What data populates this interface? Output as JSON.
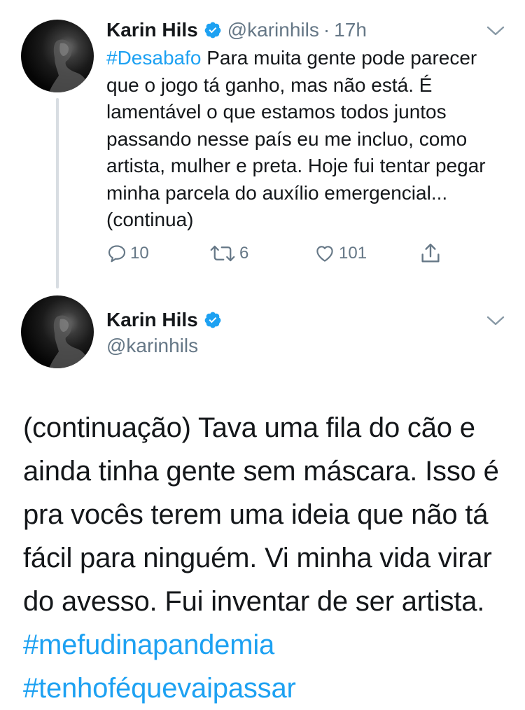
{
  "tweets": [
    {
      "name": "Karin Hils",
      "handle": "@karinhils",
      "separator": "·",
      "time": "17h",
      "hashtag": "#Desabafo",
      "text": " Para muita gente pode parecer que o jogo tá ganho, mas não está. É lamentável o que estamos todos juntos passando nesse país eu me incluo, como artista, mulher e preta. Hoje fui tentar pegar minha parcela do auxílio emergencial...(continua)",
      "actions": {
        "replies": "10",
        "retweets": "6",
        "likes": "101"
      }
    },
    {
      "name": "Karin Hils",
      "handle": "@karinhils",
      "text": "(continuação) Tava uma fila do cão e ainda tinha gente sem máscara. Isso é pra vocês terem uma ideia que não tá fácil para ninguém. Vi minha vida virar do avesso. Fui inventar de ser artista. ",
      "hashtags": [
        "#mefudinapandemia",
        "#tenhoféquevaipassar"
      ]
    }
  ],
  "icons": {
    "verified": "verified-badge-icon",
    "chevron": "chevron-down-icon",
    "reply": "reply-icon",
    "retweet": "retweet-icon",
    "like": "heart-icon",
    "share": "share-icon"
  },
  "colors": {
    "accent": "#1da1f2",
    "secondary_text": "#657786",
    "primary_text": "#14171a",
    "thread_line": "#d8dde2"
  }
}
